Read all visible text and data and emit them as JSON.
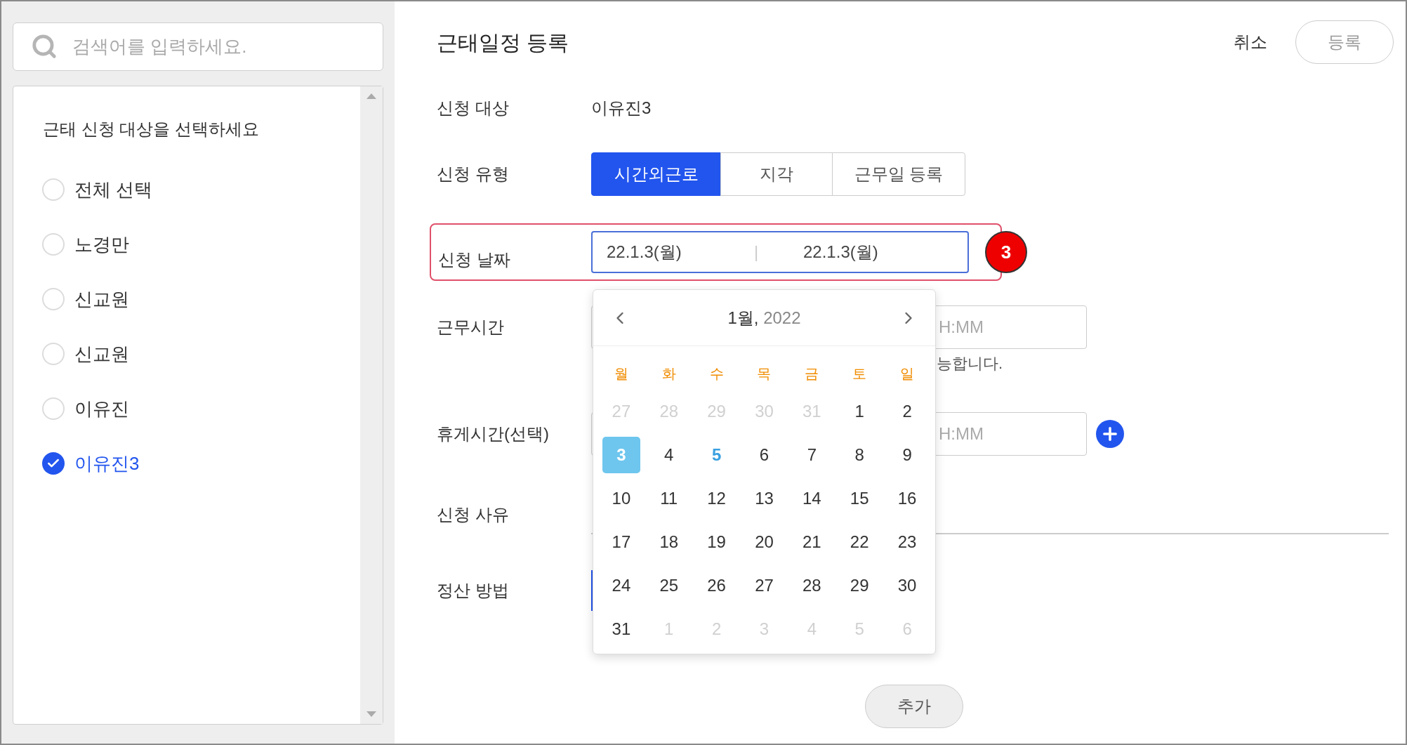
{
  "search": {
    "placeholder": "검색어를 입력하세요."
  },
  "target_list": {
    "heading": "근태 신청 대상을 선택하세요",
    "items": [
      {
        "label": "전체 선택",
        "selected": false
      },
      {
        "label": "노경만",
        "selected": false
      },
      {
        "label": "신교원",
        "selected": false
      },
      {
        "label": "신교원",
        "selected": false
      },
      {
        "label": "이유진",
        "selected": false
      },
      {
        "label": "이유진3",
        "selected": true
      }
    ]
  },
  "form": {
    "title": "근태일정 등록",
    "actions": [
      {
        "label": "취소",
        "kind": "text"
      },
      {
        "label": "등록",
        "kind": "outlined"
      }
    ],
    "target": {
      "label": "신청 대상",
      "value": "이유진3"
    },
    "type": {
      "label": "신청 유형",
      "options": [
        {
          "label": "시간외근로",
          "selected": true
        },
        {
          "label": "지각",
          "selected": false
        },
        {
          "label": "근무일 등록",
          "selected": false
        }
      ]
    },
    "date": {
      "label": "신청 날짜",
      "start": "22.1.3(월)",
      "separator": "|",
      "end": "22.1.3(월)",
      "highlighted": true,
      "badge": "3"
    },
    "work_time": {
      "label": "근무시간",
      "input_visible": "H:MM",
      "helper_visible": "능합니다."
    },
    "break_time": {
      "label": "휴게시간(선택)",
      "input_visible": "H:MM"
    },
    "reason": {
      "label": "신청 사유"
    },
    "settlement": {
      "label": "정산 방법"
    },
    "add_button": "추가"
  },
  "calendar": {
    "month": "1월,",
    "year": "2022",
    "weekdays": [
      "월",
      "화",
      "수",
      "목",
      "금",
      "토",
      "일"
    ],
    "days": [
      {
        "label": "27",
        "outside": true,
        "selected": false,
        "today": false
      },
      {
        "label": "28",
        "outside": true,
        "selected": false,
        "today": false
      },
      {
        "label": "29",
        "outside": true,
        "selected": false,
        "today": false
      },
      {
        "label": "30",
        "outside": true,
        "selected": false,
        "today": false
      },
      {
        "label": "31",
        "outside": true,
        "selected": false,
        "today": false
      },
      {
        "label": "1",
        "outside": false,
        "selected": false,
        "today": false
      },
      {
        "label": "2",
        "outside": false,
        "selected": false,
        "today": false
      },
      {
        "label": "3",
        "outside": false,
        "selected": true,
        "today": false
      },
      {
        "label": "4",
        "outside": false,
        "selected": false,
        "today": false
      },
      {
        "label": "5",
        "outside": false,
        "selected": false,
        "today": true
      },
      {
        "label": "6",
        "outside": false,
        "selected": false,
        "today": false
      },
      {
        "label": "7",
        "outside": false,
        "selected": false,
        "today": false
      },
      {
        "label": "8",
        "outside": false,
        "selected": false,
        "today": false
      },
      {
        "label": "9",
        "outside": false,
        "selected": false,
        "today": false
      },
      {
        "label": "10",
        "outside": false,
        "selected": false,
        "today": false
      },
      {
        "label": "11",
        "outside": false,
        "selected": false,
        "today": false
      },
      {
        "label": "12",
        "outside": false,
        "selected": false,
        "today": false
      },
      {
        "label": "13",
        "outside": false,
        "selected": false,
        "today": false
      },
      {
        "label": "14",
        "outside": false,
        "selected": false,
        "today": false
      },
      {
        "label": "15",
        "outside": false,
        "selected": false,
        "today": false
      },
      {
        "label": "16",
        "outside": false,
        "selected": false,
        "today": false
      },
      {
        "label": "17",
        "outside": false,
        "selected": false,
        "today": false
      },
      {
        "label": "18",
        "outside": false,
        "selected": false,
        "today": false
      },
      {
        "label": "19",
        "outside": false,
        "selected": false,
        "today": false
      },
      {
        "label": "20",
        "outside": false,
        "selected": false,
        "today": false
      },
      {
        "label": "21",
        "outside": false,
        "selected": false,
        "today": false
      },
      {
        "label": "22",
        "outside": false,
        "selected": false,
        "today": false
      },
      {
        "label": "23",
        "outside": false,
        "selected": false,
        "today": false
      },
      {
        "label": "24",
        "outside": false,
        "selected": false,
        "today": false
      },
      {
        "label": "25",
        "outside": false,
        "selected": false,
        "today": false
      },
      {
        "label": "26",
        "outside": false,
        "selected": false,
        "today": false
      },
      {
        "label": "27",
        "outside": false,
        "selected": false,
        "today": false
      },
      {
        "label": "28",
        "outside": false,
        "selected": false,
        "today": false
      },
      {
        "label": "29",
        "outside": false,
        "selected": false,
        "today": false
      },
      {
        "label": "30",
        "outside": false,
        "selected": false,
        "today": false
      },
      {
        "label": "31",
        "outside": false,
        "selected": false,
        "today": false
      },
      {
        "label": "1",
        "outside": true,
        "selected": false,
        "today": false
      },
      {
        "label": "2",
        "outside": true,
        "selected": false,
        "today": false
      },
      {
        "label": "3",
        "outside": true,
        "selected": false,
        "today": false
      },
      {
        "label": "4",
        "outside": true,
        "selected": false,
        "today": false
      },
      {
        "label": "5",
        "outside": true,
        "selected": false,
        "today": false
      },
      {
        "label": "6",
        "outside": true,
        "selected": false,
        "today": false
      }
    ]
  }
}
